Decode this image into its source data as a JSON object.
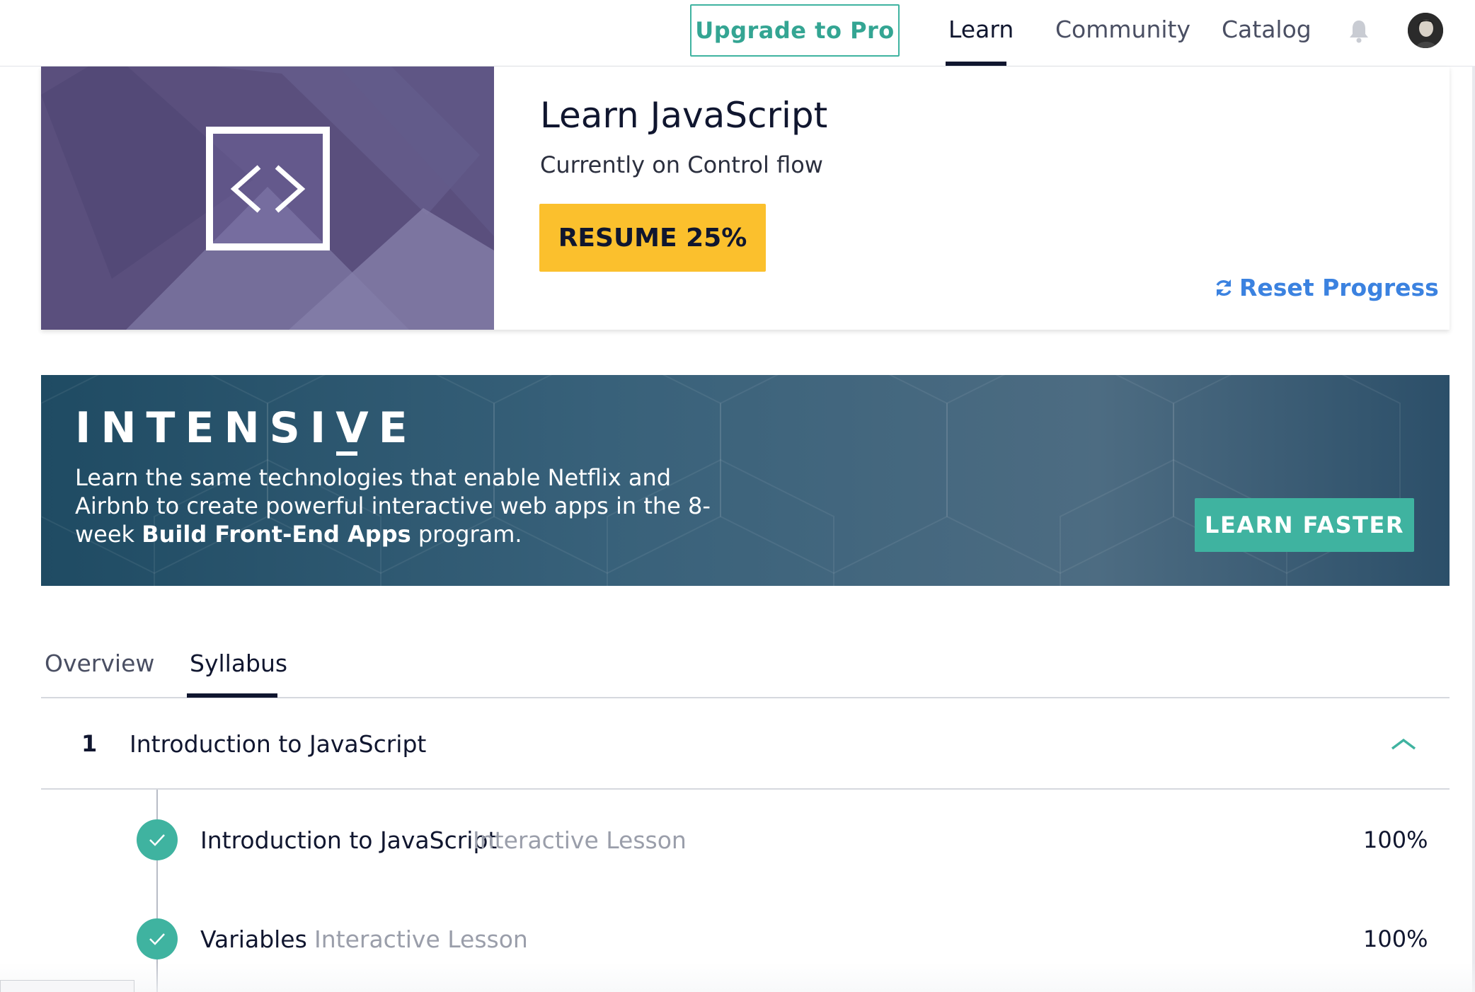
{
  "nav": {
    "upgrade_label": "Upgrade to Pro",
    "links": [
      {
        "label": "Learn",
        "active": true
      },
      {
        "label": "Community",
        "active": false
      },
      {
        "label": "Catalog",
        "active": false
      }
    ],
    "icons": {
      "notifications": "bell-icon",
      "profile": "avatar"
    }
  },
  "course": {
    "title": "Learn JavaScript",
    "subtitle": "Currently on Control flow",
    "resume_label": "RESUME 25%",
    "progress_percent": 25,
    "reset_label": "Reset Progress",
    "art_icon": "code-brackets-icon"
  },
  "banner": {
    "heading": "INTENSIVE",
    "text_prefix": "Learn the same technologies that enable Netflix and Airbnb to create powerful interactive web apps in the 8-week ",
    "text_bold": "Build Front-End Apps",
    "text_suffix": " program.",
    "cta_label": "LEARN FASTER"
  },
  "tabs": [
    {
      "label": "Overview",
      "active": false
    },
    {
      "label": "Syllabus",
      "active": true
    }
  ],
  "syllabus": {
    "unit": {
      "number": "1",
      "title": "Introduction to JavaScript",
      "expanded": true
    },
    "lessons": [
      {
        "title": "Introduction to JavaScript",
        "type": "Interactive Lesson",
        "progress": "100%",
        "complete": true
      },
      {
        "title": "Variables",
        "type": "Interactive Lesson",
        "progress": "100%",
        "complete": true
      }
    ]
  },
  "colors": {
    "accent_teal": "#3fb3a0",
    "resume_yellow": "#fbc02d",
    "link_blue": "#3b82e0",
    "navy": "#10162f",
    "art_purple": "#5b517e"
  }
}
